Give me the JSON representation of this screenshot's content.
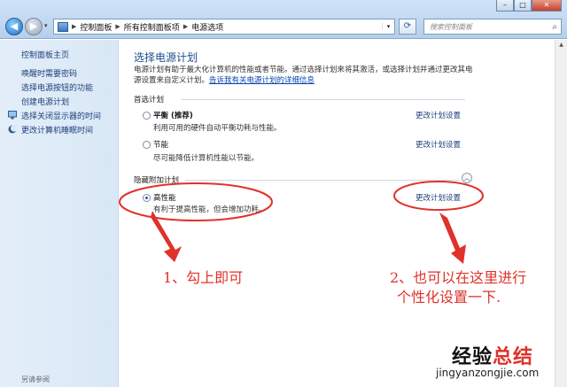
{
  "window": {
    "minimize": "–",
    "maximize": "□",
    "close": "✕"
  },
  "address": {
    "crumbs": [
      "控制面板",
      "所有控制面板项",
      "电源选项"
    ],
    "search_placeholder": "搜索控制面板"
  },
  "sidebar": {
    "home": "控制面板主页",
    "items": [
      {
        "label": "唤醒时需要密码",
        "icon": ""
      },
      {
        "label": "选择电源按钮的功能",
        "icon": ""
      },
      {
        "label": "创建电源计划",
        "icon": ""
      },
      {
        "label": "选择关闭显示器的时间",
        "icon": "monitor-icon"
      },
      {
        "label": "更改计算机睡眠时间",
        "icon": "moon-icon"
      }
    ],
    "see_also": "另请参阅"
  },
  "main": {
    "title": "选择电源计划",
    "description": "电源计划有助于最大化计算机的性能或者节能。通过选择计划来将其激活，或选择计划并通过更改其电源设置来自定义计划。",
    "description_link": "告诉我有关电源计划的详细信息",
    "preferred_label": "首选计划",
    "hidden_label": "隐藏附加计划",
    "plans": [
      {
        "name": "平衡 (推荐)",
        "desc": "利用可用的硬件自动平衡功耗与性能。",
        "link": "更改计划设置",
        "selected": false
      },
      {
        "name": "节能",
        "desc": "尽可能降低计算机性能以节能。",
        "link": "更改计划设置",
        "selected": false
      },
      {
        "name": "高性能",
        "desc": "有利于提高性能，但会增加功耗。",
        "link": "更改计划设置",
        "selected": true
      }
    ]
  },
  "annotations": {
    "note1": "1、勾上即可",
    "note2_line1": "2、也可以在这里进行",
    "note2_line2": "个性化设置一下.",
    "color": "#e0312a"
  },
  "watermark": {
    "prefix": "经验",
    "accent": "总结",
    "url": "jingyanzongjie.com"
  }
}
